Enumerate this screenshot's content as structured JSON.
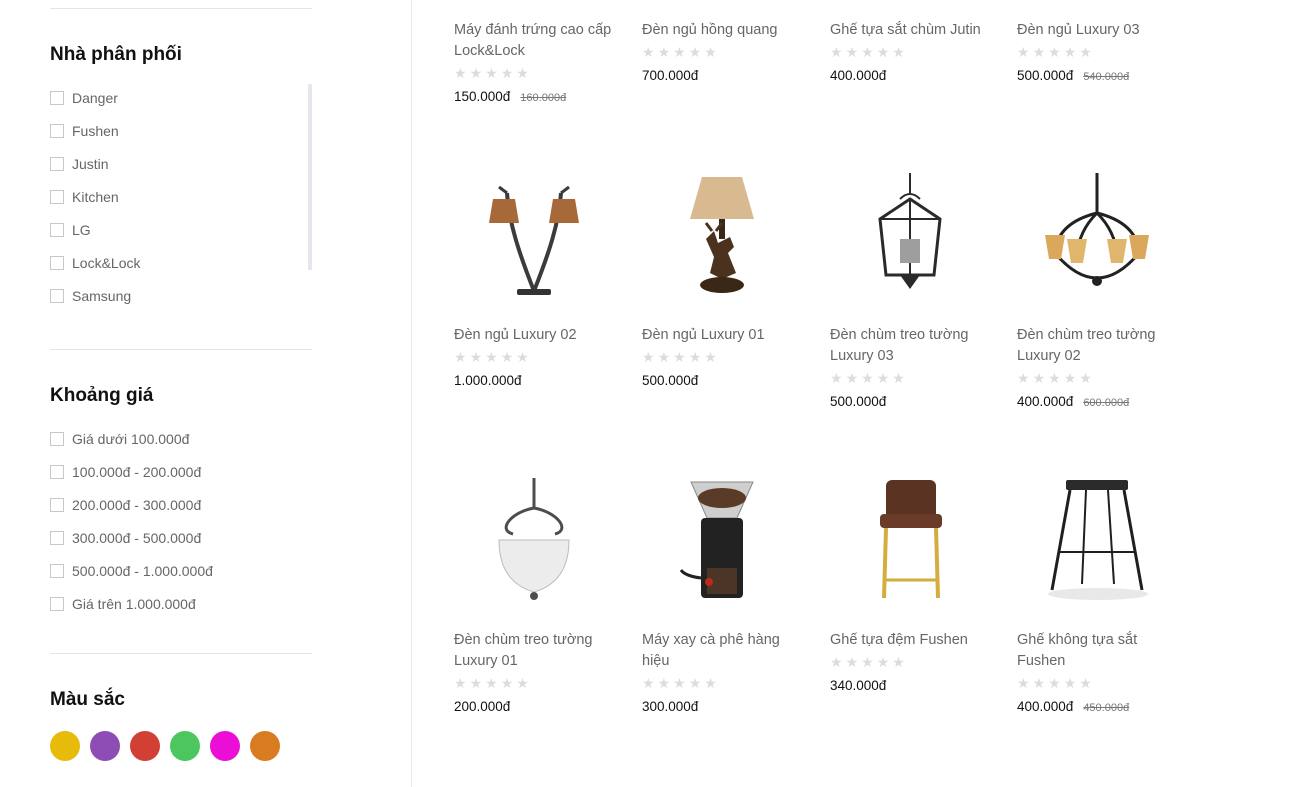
{
  "filters": {
    "distributor": {
      "title": "Nhà phân phối",
      "items": [
        "Danger",
        "Fushen",
        "Justin",
        "Kitchen",
        "LG",
        "Lock&Lock",
        "Samsung"
      ]
    },
    "price_range": {
      "title": "Khoảng giá",
      "items": [
        "Giá dưới 100.000đ",
        "100.000đ - 200.000đ",
        "200.000đ - 300.000đ",
        "300.000đ - 500.000đ",
        "500.000đ - 1.000.000đ",
        "Giá trên 1.000.000đ"
      ]
    },
    "color": {
      "title": "Màu sắc",
      "swatches": [
        "#e6bb0a",
        "#8e4db5",
        "#d13f35",
        "#4cc75f",
        "#ea0ed6",
        "#d97b20"
      ]
    }
  },
  "products": [
    {
      "name": "Máy đánh trứng cao cấp Lock&Lock",
      "price": "150.000đ",
      "old_price": "160.000đ",
      "rating": 0,
      "image": "none"
    },
    {
      "name": "Đèn ngủ hồng quang",
      "price": "700.000đ",
      "old_price": "",
      "rating": 0,
      "image": "none"
    },
    {
      "name": "Ghế tựa sắt chùm Jutin",
      "price": "400.000đ",
      "old_price": "",
      "rating": 0,
      "image": "none"
    },
    {
      "name": "Đèn ngủ Luxury 03",
      "price": "500.000đ",
      "old_price": "540.000đ",
      "rating": 0,
      "image": "none"
    },
    {
      "name": "Đèn ngủ Luxury 02",
      "price": "1.000.000đ",
      "old_price": "",
      "rating": 0,
      "image": "twin-lamp"
    },
    {
      "name": "Đèn ngủ Luxury 01",
      "price": "500.000đ",
      "old_price": "",
      "rating": 0,
      "image": "deer-lamp"
    },
    {
      "name": "Đèn chùm treo tường Luxury 03",
      "price": "500.000đ",
      "old_price": "",
      "rating": 0,
      "image": "lantern"
    },
    {
      "name": "Đèn chùm treo tường Luxury 02",
      "price": "400.000đ",
      "old_price": "600.000đ",
      "rating": 0,
      "image": "chandelier"
    },
    {
      "name": "Đèn chùm treo tường Luxury 01",
      "price": "200.000đ",
      "old_price": "",
      "rating": 0,
      "image": "pendant"
    },
    {
      "name": "Máy xay cà phê hàng hiệu",
      "price": "300.000đ",
      "old_price": "",
      "rating": 0,
      "image": "grinder"
    },
    {
      "name": "Ghế tựa đệm Fushen",
      "price": "340.000đ",
      "old_price": "",
      "rating": 0,
      "image": "barstool"
    },
    {
      "name": "Ghế không tựa sắt Fushen",
      "price": "400.000đ",
      "old_price": "450.000đ",
      "rating": 0,
      "image": "iron-stool"
    }
  ]
}
